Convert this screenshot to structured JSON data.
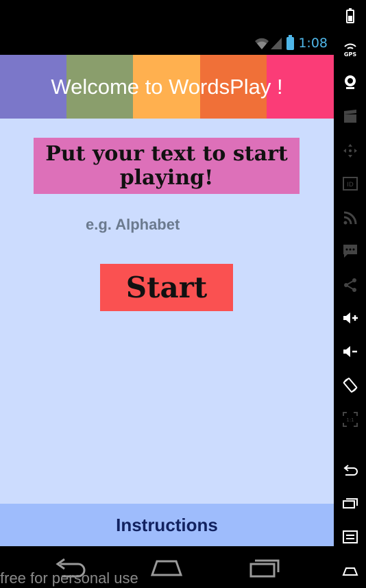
{
  "status_bar": {
    "time": "1:08"
  },
  "header": {
    "title": "Welcome to WordsPlay !",
    "stripe_colors": [
      "#7b77c9",
      "#8a9e6c",
      "#ffb04f",
      "#f07038",
      "#fb3c77"
    ]
  },
  "main": {
    "prompt_text": "Put your text to start playing!",
    "input": {
      "placeholder": "e.g. Alphabet",
      "value": ""
    },
    "start_label": "Start"
  },
  "footer": {
    "instructions_label": "Instructions"
  },
  "watermark": "free for personal use",
  "colors": {
    "content_bg": "#ccdcfe",
    "prompt_bg": "#dd70b9",
    "start_bg": "#fa5151",
    "footer_bg": "#9ebcfc",
    "status_accent": "#4fb6e8"
  },
  "sidebar_icons": [
    "battery-icon",
    "gps-icon",
    "webcam-icon",
    "clapperboard-icon",
    "move-icon",
    "id-icon",
    "rss-icon",
    "message-icon",
    "share-icon",
    "volume-up-icon",
    "volume-down-icon",
    "rotate-icon",
    "scale-icon",
    "back-icon",
    "recent-apps-icon",
    "menu-icon",
    "home-icon"
  ],
  "sidebar_gps_label": "GPS",
  "sidebar_id_label": "ID",
  "sidebar_scale_label": "1:1"
}
